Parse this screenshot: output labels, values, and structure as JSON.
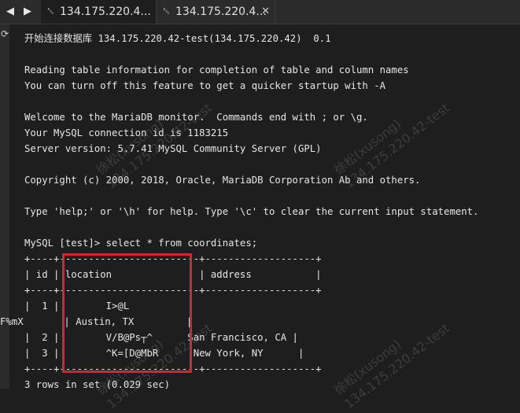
{
  "tabs": [
    {
      "label": "134.175.220.4...",
      "icon": "terminal-tab-icon"
    },
    {
      "label": "134.175.220.4...",
      "icon": "terminal-tab-icon"
    }
  ],
  "nav": {
    "back": "◀",
    "forward": "▶",
    "close": "✕",
    "refresh": "⟳",
    "tab_icon": "␛"
  },
  "terminal": {
    "lines": [
      "开始连接数据库 134.175.220.42-test(134.175.220.42)  0.1",
      "",
      "Reading table information for completion of table and column names",
      "You can turn off this feature to get a quicker startup with -A",
      "",
      "Welcome to the MariaDB monitor.  Commands end with ; or \\g.",
      "Your MySQL connection id is 1183215",
      "Server version: 5.7.41 MySQL Community Server (GPL)",
      "",
      "Copyright (c) 2000, 2018, Oracle, MariaDB Corporation Ab and others.",
      "",
      "Type 'help;' or '\\h' for help. Type '\\c' to clear the current input statement.",
      "",
      "MySQL [test]> select * from coordinates;",
      "+----+------------------------+-------------------+",
      "| id | location               | address           |",
      "+----+------------------------+-------------------+",
      "|  1 |        I>@L",
      "F%mX       | Austin, TX         |",
      "|  2 |        V/B@Ps┬^      San Francisco, CA |",
      "|  3 |        ^K=[D@MbR      New York, NY      |",
      "+----+------------------------+-------------------+",
      "3 rows in set (0.029 sec)"
    ]
  },
  "watermark": {
    "name": "徐松(xusong)",
    "host": "134.175.220.42-test"
  },
  "colors": {
    "highlight": "#e0202a",
    "background": "#1e1e1e",
    "text": "#e6e6e6"
  }
}
